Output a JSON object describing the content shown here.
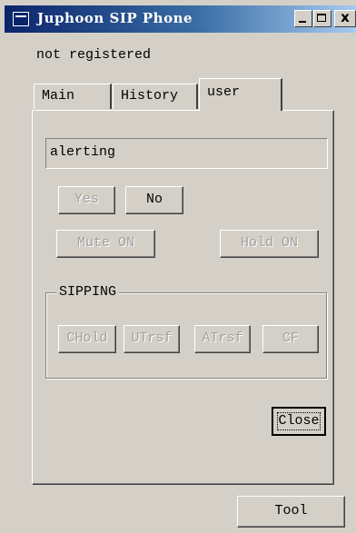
{
  "window": {
    "title": "Juphoon SIP Phone",
    "close_glyph": "x"
  },
  "status_text": "not registered",
  "tabs": [
    {
      "label": "Main"
    },
    {
      "label": "History"
    },
    {
      "label": "user"
    }
  ],
  "call_state": "alerting",
  "buttons": {
    "yes": "Yes",
    "no": "No",
    "mute": "Mute ON",
    "hold": "Hold ON"
  },
  "sipping": {
    "label": "SIPPING",
    "chold": "CHold",
    "utrsf": "UTrsf",
    "atrsf": "ATrsf",
    "cf": "CF"
  },
  "close_label": "Close",
  "tool_label": "Tool"
}
